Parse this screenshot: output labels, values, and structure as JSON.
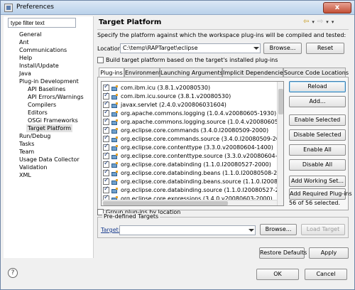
{
  "window": {
    "title": "Preferences",
    "close_glyph": "x"
  },
  "sidebar": {
    "filter_value": "type filter text",
    "items": [
      {
        "label": "General"
      },
      {
        "label": "Ant"
      },
      {
        "label": "Communications"
      },
      {
        "label": "Help"
      },
      {
        "label": "Install/Update"
      },
      {
        "label": "Java"
      },
      {
        "label": "Plug-in Development"
      },
      {
        "label": "API Baselines"
      },
      {
        "label": "API Errors/Warnings"
      },
      {
        "label": "Compilers"
      },
      {
        "label": "Editors"
      },
      {
        "label": "OSGi Frameworks"
      },
      {
        "label": "Target Platform",
        "selected": true
      },
      {
        "label": "Run/Debug"
      },
      {
        "label": "Tasks"
      },
      {
        "label": "Team"
      },
      {
        "label": "Usage Data Collector"
      },
      {
        "label": "Validation"
      },
      {
        "label": "XML"
      }
    ]
  },
  "page": {
    "title": "Target Platform",
    "description": "Specify the platform against which the workspace plug-ins will be compiled and tested:",
    "location_label": "Location:",
    "location_value": "C:\\temp\\RAPTarget\\eclipse",
    "browse_label": "Browse...",
    "reset_label": "Reset",
    "build_checkbox_label": "Build target platform based on the target's installed plug-ins",
    "build_checked": false,
    "tabs": [
      {
        "label": "Plug-ins",
        "active": true
      },
      {
        "label": "Environment"
      },
      {
        "label": "Launching Arguments"
      },
      {
        "label": "Implicit Dependencies"
      },
      {
        "label": "Source Code Locations"
      }
    ],
    "plugins": [
      {
        "name": "com.ibm.icu (3.8.1.v20080530)",
        "checked": true
      },
      {
        "name": "com.ibm.icu.source (3.8.1.v20080530)",
        "checked": true
      },
      {
        "name": "javax.servlet (2.4.0.v200806031604)",
        "checked": true
      },
      {
        "name": "org.apache.commons.logging (1.0.4.v20080605-1930)",
        "checked": true
      },
      {
        "name": "org.apache.commons.logging.source (1.0.4.v20080605-1930)",
        "checked": true
      },
      {
        "name": "org.eclipse.core.commands (3.4.0.I20080509-2000)",
        "checked": true
      },
      {
        "name": "org.eclipse.core.commands.source (3.4.0.I20080509-2000)",
        "checked": true
      },
      {
        "name": "org.eclipse.core.contenttype (3.3.0.v20080604-1400)",
        "checked": true
      },
      {
        "name": "org.eclipse.core.contenttype.source (3.3.0.v20080604-1400)",
        "checked": true
      },
      {
        "name": "org.eclipse.core.databinding (1.1.0.I20080527-2000)",
        "checked": true
      },
      {
        "name": "org.eclipse.core.databinding.beans (1.1.0.I20080508-2000a)",
        "checked": true
      },
      {
        "name": "org.eclipse.core.databinding.beans.source (1.1.0.I20080508-2000",
        "checked": true
      },
      {
        "name": "org.eclipse.core.databinding.source (1.1.0.I20080527-2000)",
        "checked": true
      },
      {
        "name": "org.eclipse.core.expressions (3.4.0.v20080603-2000)",
        "checked": true
      }
    ],
    "side_buttons": [
      {
        "label": "Reload",
        "default": true
      },
      {
        "label": "Add..."
      },
      {
        "label": "Enable Selected"
      },
      {
        "label": "Disable Selected"
      },
      {
        "label": "Enable All"
      },
      {
        "label": "Disable All"
      },
      {
        "label": "Add Working Set..."
      },
      {
        "label": "Add Required Plug-ins"
      }
    ],
    "selected_count": "56 of 56 selected.",
    "group_checkbox_label": "Group plug-ins by location",
    "group_checked": false,
    "predefined_legend": "Pre-defined Targets",
    "target_label": "Target:",
    "target_value": "",
    "target_browse_label": "Browse...",
    "load_target_label": "Load Target",
    "restore_defaults_label": "Restore Defaults",
    "apply_label": "Apply"
  },
  "footer": {
    "ok_label": "OK",
    "cancel_label": "Cancel",
    "help_glyph": "?"
  }
}
